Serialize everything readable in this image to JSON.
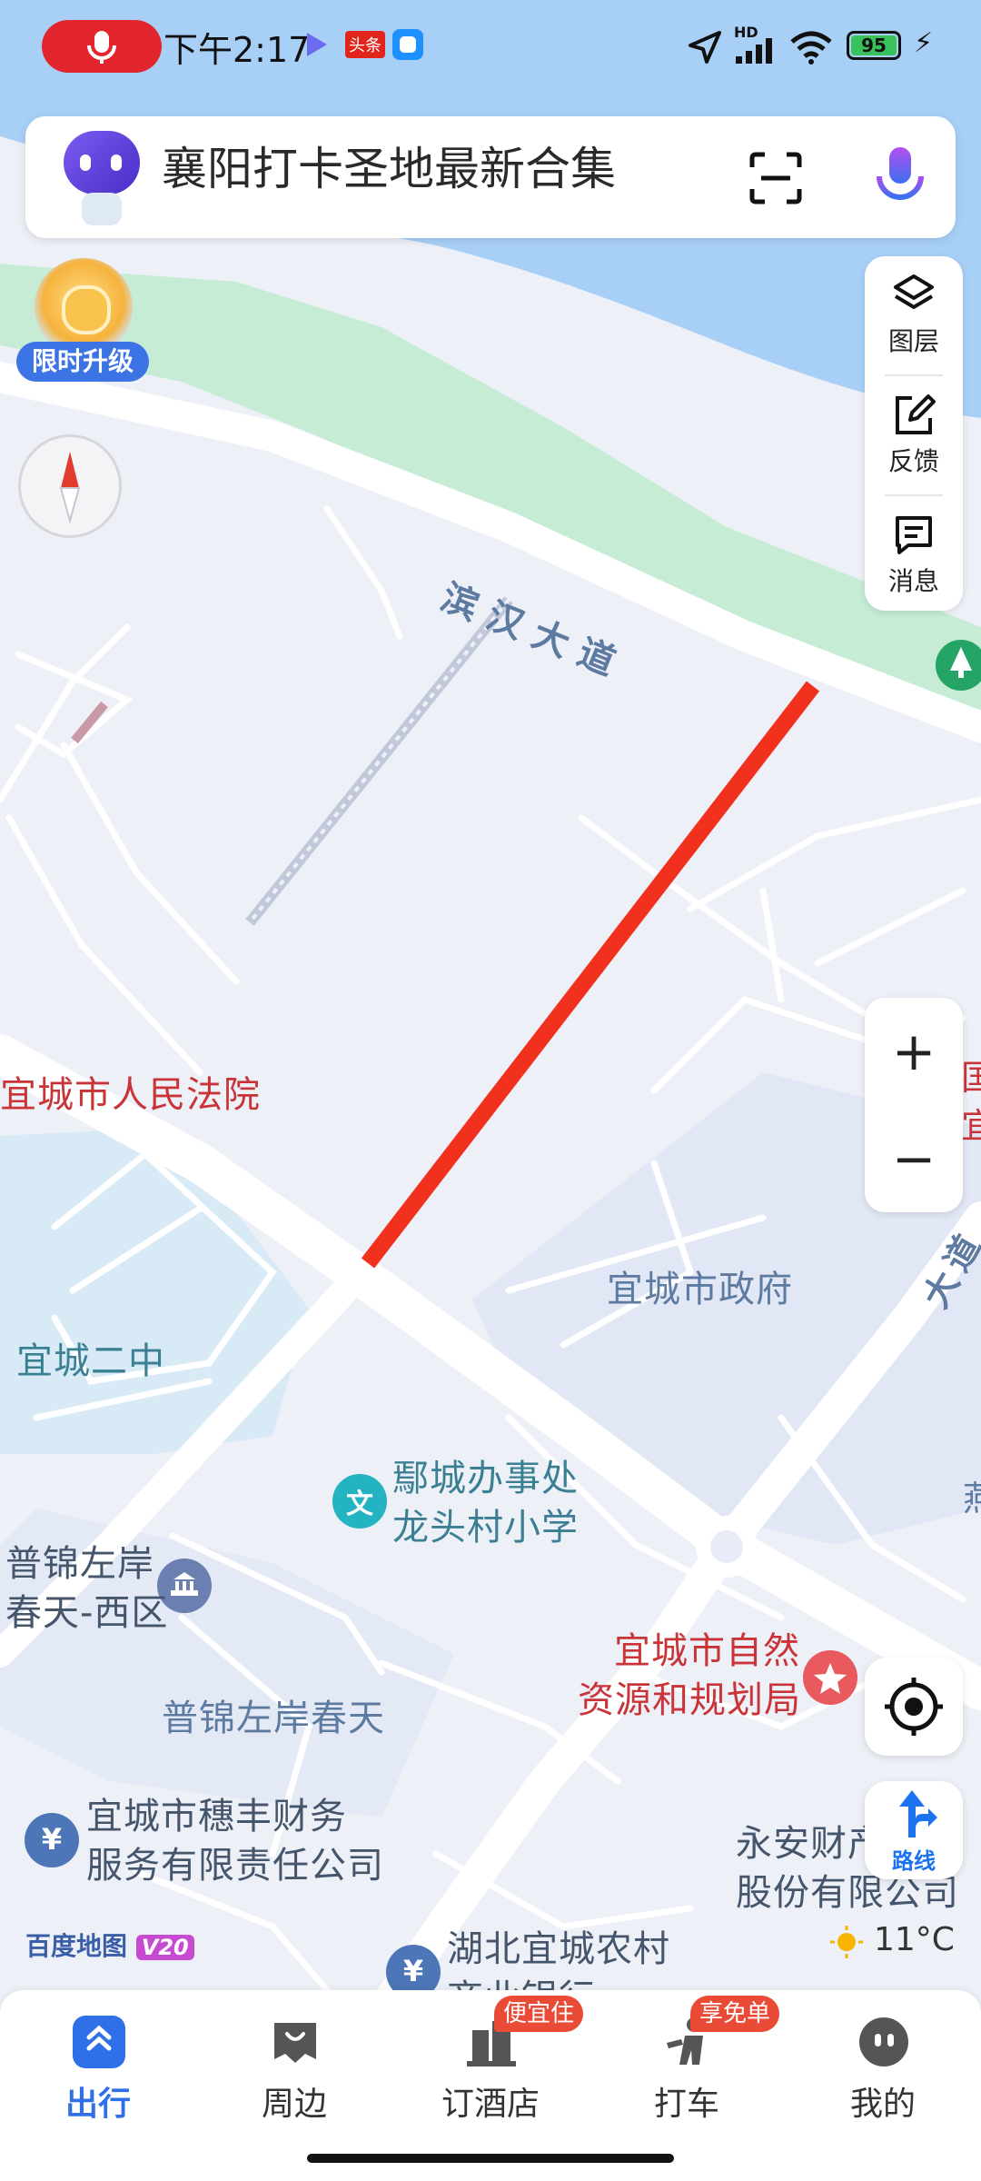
{
  "status_bar": {
    "time": "下午2:17",
    "news_badge": "头条",
    "network": "HD",
    "battery": "95"
  },
  "search": {
    "query": "襄阳打卡圣地最新合集"
  },
  "promo": {
    "label": "限时升级"
  },
  "tools": {
    "layers": "图层",
    "feedback": "反馈",
    "messages": "消息"
  },
  "zoom": {
    "in": "+",
    "out": "−"
  },
  "route_button": {
    "label": "路线"
  },
  "map": {
    "road_binhan": "滨汉大道",
    "road_right": "大道",
    "court": "宜城市人民法院",
    "government": "宜城市政府",
    "school_2": "宜城二中",
    "yingcheng_line1": "鄢城办事处",
    "yingcheng_line2": "龙头村小学",
    "pujin_line1": "普锦左岸",
    "pujin_line2": "春天-西区",
    "pujin_spring": "普锦左岸春天",
    "resources_line1": "宜城市自然",
    "resources_line2": "资源和规划局",
    "suifeng_line1": "宜城市穗丰财务",
    "suifeng_line2": "服务有限责任公司",
    "yongan_line1": "永安财产",
    "yongan_line2": "股份有限公司",
    "bank_line1": "湖北宜城农村",
    "bank_line2": "商业银行",
    "edge_right_1": "国",
    "edge_right_2": "宜",
    "edge_right_3": "燕",
    "brand": "百度地图",
    "brand_version": "V20",
    "temperature": "11°C"
  },
  "bottom_nav": {
    "items": [
      {
        "label": "出行",
        "active": true
      },
      {
        "label": "周边",
        "active": false
      },
      {
        "label": "订酒店",
        "active": false,
        "badge": "便宜住"
      },
      {
        "label": "打车",
        "active": false,
        "badge": "享免单"
      },
      {
        "label": "我的",
        "active": false
      }
    ]
  },
  "colors": {
    "accent": "#2f6fe8",
    "route_red": "#f2301e",
    "river": "#a8d0f7",
    "park": "#c6ecd6",
    "poi_red": "#c93438"
  }
}
